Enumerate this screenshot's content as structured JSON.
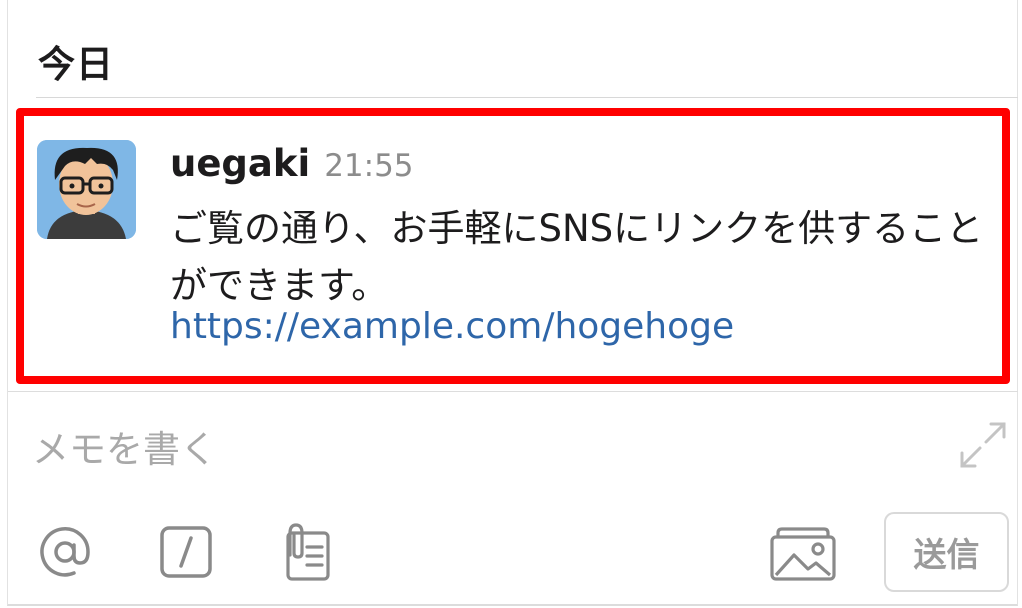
{
  "header": {
    "date_label": "今日"
  },
  "message": {
    "username": "uegaki",
    "timestamp": "21:55",
    "text": "ご覧の通り、お手軽にSNSにリンクを供することができます。",
    "link": "https://example.com/hogehoge"
  },
  "composer": {
    "placeholder": "メモを書く",
    "send_label": "送信"
  },
  "icons": {
    "avatar": "avatar-portrait",
    "expand": "expand-icon",
    "mention": "at-sign-icon",
    "slash": "slash-command-icon",
    "attachment": "file-attachment-icon",
    "photo": "photo-library-icon"
  },
  "colors": {
    "highlight": "#ff0000",
    "link": "#2e66a9",
    "timestamp": "#8c8c8c",
    "placeholder": "#a9a9a9"
  }
}
